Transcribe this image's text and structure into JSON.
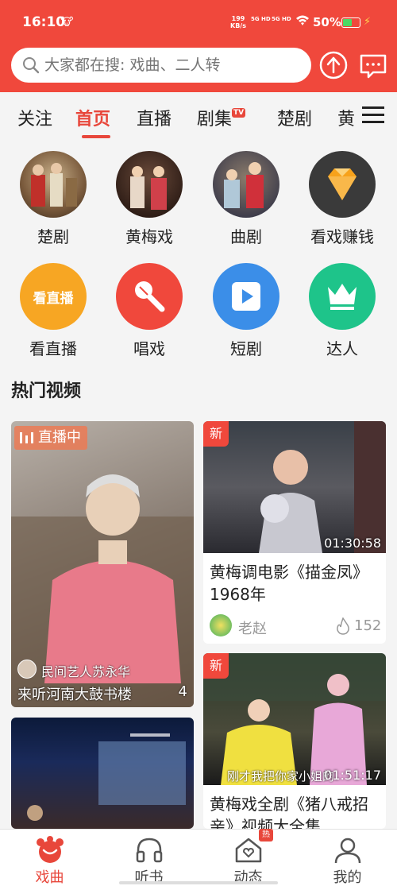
{
  "status": {
    "time": "16:10",
    "speed_top": "199",
    "speed_bottom": "KB/s",
    "sig1": "5G HD",
    "sig2": "5G HD",
    "battery": "50%",
    "accent": "#f0483c"
  },
  "search": {
    "placeholder": "大家都在搜: 戏曲、二人转"
  },
  "tabs": [
    {
      "label": "关注"
    },
    {
      "label": "首页",
      "active": true
    },
    {
      "label": "直播"
    },
    {
      "label": "剧集",
      "badge": "TV"
    },
    {
      "label": "楚剧"
    },
    {
      "label": "黄"
    }
  ],
  "categories": [
    {
      "label": "楚剧",
      "icon": "opera-photo"
    },
    {
      "label": "黄梅戏",
      "icon": "opera-photo"
    },
    {
      "label": "曲剧",
      "icon": "opera-photo"
    },
    {
      "label": "看戏赚钱",
      "icon": "diamond-icon"
    },
    {
      "label": "看直播",
      "icon_text": "看直播"
    },
    {
      "label": "唱戏",
      "icon": "microphone-icon"
    },
    {
      "label": "短剧",
      "icon": "play-icon"
    },
    {
      "label": "达人",
      "icon": "crown-icon"
    }
  ],
  "section_title": "热门视频",
  "cards": {
    "live": {
      "badge": "直播中",
      "host": "民间艺人苏永华",
      "title": "来听河南大鼓书楼",
      "count": "4"
    },
    "video1": {
      "tag": "新",
      "duration": "01:30:58",
      "title": "黄梅调电影《描金凤》1968年",
      "author": "老赵",
      "likes": "152"
    },
    "video2": {
      "tag": "新",
      "duration": "01:51:17",
      "subtitle": "刚才我把你家小姐的",
      "title": "黄梅戏全剧《猪八戒招亲》视频大全集"
    }
  },
  "bottom_nav": [
    {
      "label": "戏曲",
      "active": true
    },
    {
      "label": "听书"
    },
    {
      "label": "动态",
      "badge": "热"
    },
    {
      "label": "我的"
    }
  ]
}
